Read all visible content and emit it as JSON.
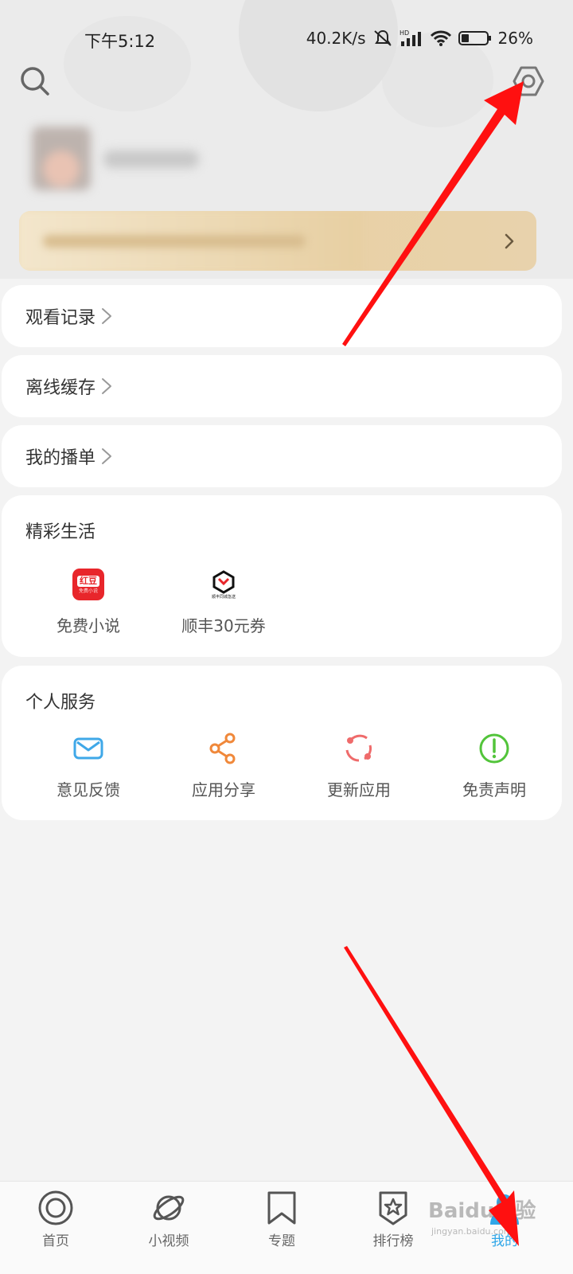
{
  "status_bar": {
    "time": "下午5:12",
    "network_speed": "40.2K/s",
    "battery": "26%"
  },
  "header": {
    "search_icon": "search-icon",
    "settings_icon": "settings-icon"
  },
  "rows": [
    {
      "label": "观看记录"
    },
    {
      "label": "离线缓存"
    },
    {
      "label": "我的播单"
    }
  ],
  "life_section": {
    "title": "精彩生活",
    "items": [
      {
        "label": "免费小说",
        "icon_text": "红豆",
        "icon_subtext": "免费小说"
      },
      {
        "label": "顺丰30元券",
        "icon_caption": "顺丰同城急送"
      }
    ]
  },
  "service_section": {
    "title": "个人服务",
    "items": [
      {
        "label": "意见反馈",
        "icon": "mail-icon",
        "color": "#3fa8e8"
      },
      {
        "label": "应用分享",
        "icon": "share-icon",
        "color": "#f0883a"
      },
      {
        "label": "更新应用",
        "icon": "refresh-icon",
        "color": "#ef6b6b"
      },
      {
        "label": "免责声明",
        "icon": "exclamation-icon",
        "color": "#52c43a"
      }
    ]
  },
  "tab_bar": {
    "active_color": "#2fa6e8",
    "tabs": [
      {
        "label": "首页",
        "icon": "home-icon"
      },
      {
        "label": "小视频",
        "icon": "planet-icon"
      },
      {
        "label": "专题",
        "icon": "bookmark-icon"
      },
      {
        "label": "排行榜",
        "icon": "star-badge-icon"
      },
      {
        "label": "我的",
        "icon": "profile-icon",
        "active": true
      }
    ]
  },
  "watermark": {
    "text": "Baidu经验",
    "sub": "jingyan.baidu.com"
  }
}
